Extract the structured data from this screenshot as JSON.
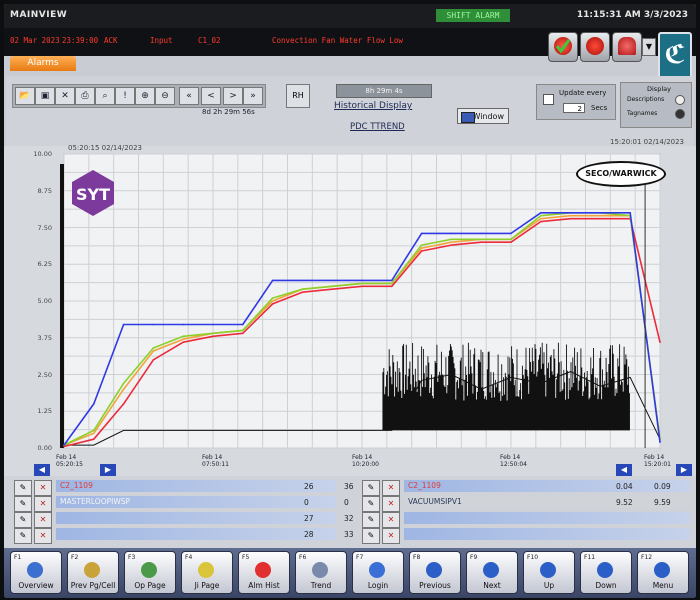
{
  "titlebar": {
    "app": "MAINVIEW",
    "shift_badge": "SHIFT ALARM",
    "clock": "11:15:31 AM 3/3/2023"
  },
  "alarm": {
    "date": "02 Mar 2023",
    "time": "23:39:00",
    "ack": "ACK",
    "type": "Input",
    "tag": "C1_02",
    "message": "Convection Fan Water Flow Low"
  },
  "alarms_tab": "Alarms",
  "toolbar": {
    "buttons": [
      "file-open-icon",
      "save-icon",
      "cut-icon",
      "print-icon",
      "search-icon",
      "alert-icon",
      "zoom-in-icon",
      "zoom-out-icon",
      "scroll-first-icon",
      "scroll-left-icon",
      "scroll-right-icon",
      "scroll-last-icon"
    ],
    "ranges": "8d  2h  29m  56s",
    "rh_label": "RH",
    "range_display": "8h 29m 4s",
    "historical_title": "Historical Display",
    "tag_title": "PDC TTREND",
    "window_label": "Window",
    "update_label": "Update every",
    "update_value": "2",
    "update_unit": "Secs",
    "display_title": "Display",
    "display_opt1": "Descriptions",
    "display_opt2": "Tagnames"
  },
  "chart": {
    "start_stamp": "05:20:15 02/14/2023",
    "end_stamp": "15:20:01 02/14/2023",
    "y_ticks": [
      "10.00",
      "8.75",
      "7.50",
      "6.25",
      "5.00",
      "3.75",
      "2.50",
      "1.25",
      "0.00"
    ],
    "x_labels": [
      {
        "d": "Feb 14",
        "t": "05:20:15"
      },
      {
        "d": "Feb 14",
        "t": "07:50:11"
      },
      {
        "d": "Feb 14",
        "t": "10:20:00"
      },
      {
        "d": "Feb 14",
        "t": "12:50:04"
      },
      {
        "d": "Feb 14",
        "t": "15:20:01"
      }
    ],
    "logo_left": "SYT",
    "logo_right": "SECO/WARWICK"
  },
  "chart_data": {
    "type": "line",
    "title": "PDC TTREND",
    "ylim": [
      0,
      10
    ],
    "x": [
      "05:20",
      "05:50",
      "06:20",
      "06:50",
      "07:20",
      "07:50",
      "08:20",
      "08:50",
      "09:20",
      "09:50",
      "10:20",
      "10:50",
      "11:20",
      "11:50",
      "12:20",
      "12:50",
      "13:20",
      "13:50",
      "14:20",
      "14:50",
      "15:20"
    ],
    "series": [
      {
        "name": "blue",
        "values": [
          0.1,
          1.5,
          4.2,
          4.2,
          4.2,
          4.2,
          4.2,
          5.7,
          5.7,
          5.7,
          5.7,
          5.7,
          7.3,
          7.3,
          7.3,
          7.3,
          8.0,
          8.0,
          8.0,
          8.0,
          0.2
        ]
      },
      {
        "name": "green",
        "values": [
          0.1,
          0.6,
          2.2,
          3.4,
          3.8,
          3.9,
          4.0,
          5.1,
          5.4,
          5.5,
          5.6,
          5.6,
          6.9,
          7.1,
          7.1,
          7.1,
          7.9,
          8.0,
          8.0,
          7.9,
          0.3
        ]
      },
      {
        "name": "orange",
        "values": [
          0.1,
          0.5,
          2.0,
          3.3,
          3.7,
          3.9,
          4.0,
          5.0,
          5.4,
          5.5,
          5.6,
          5.6,
          6.8,
          7.0,
          7.1,
          7.1,
          7.8,
          7.9,
          7.9,
          7.9,
          0.3
        ]
      },
      {
        "name": "red",
        "values": [
          0.05,
          0.3,
          1.5,
          3.0,
          3.6,
          3.8,
          3.9,
          4.9,
          5.3,
          5.4,
          5.5,
          5.5,
          6.7,
          6.9,
          7.0,
          7.0,
          7.7,
          7.8,
          7.8,
          7.8,
          3.6
        ]
      },
      {
        "name": "black",
        "values": [
          0.1,
          0.1,
          0.6,
          0.6,
          0.6,
          0.6,
          0.6,
          0.6,
          0.6,
          0.6,
          0.6,
          0.6,
          2.3,
          2.5,
          2.0,
          2.4,
          2.2,
          2.6,
          2.1,
          2.4,
          0.3
        ]
      }
    ]
  },
  "pens": {
    "left": [
      {
        "name": "C2_1109",
        "v1": "26",
        "v2": "36"
      },
      {
        "name": "MASTERLOOPIWSP",
        "v1": "0",
        "v2": "0"
      },
      {
        "name": "",
        "v1": "27",
        "v2": "32"
      },
      {
        "name": "",
        "v1": "28",
        "v2": "33"
      }
    ],
    "right": [
      {
        "name": "C2_1109",
        "v1": "0.04",
        "v2": "0.09"
      },
      {
        "name": "VACUUMSIPV1",
        "v1": "9.52",
        "v2": "9.59"
      },
      {
        "name": "",
        "v1": "",
        "v2": ""
      },
      {
        "name": "",
        "v1": "",
        "v2": ""
      }
    ]
  },
  "navbar": [
    {
      "key": "F1",
      "label": "Overview"
    },
    {
      "key": "F2",
      "label": "Prev Pg/Cell"
    },
    {
      "key": "F3",
      "label": "Op Page"
    },
    {
      "key": "F4",
      "label": "Ji Page"
    },
    {
      "key": "F5",
      "label": "Alm Hist"
    },
    {
      "key": "F6",
      "label": "Trend"
    },
    {
      "key": "F7",
      "label": "Login"
    },
    {
      "key": "F8",
      "label": "Previous"
    },
    {
      "key": "F9",
      "label": "Next"
    },
    {
      "key": "F10",
      "label": "Up"
    },
    {
      "key": "F11",
      "label": "Down"
    },
    {
      "key": "F12",
      "label": "Menu"
    }
  ],
  "colors": {
    "blue": "#2f39e6",
    "green": "#8bd12a",
    "orange": "#f2a33a",
    "red": "#ec2b3b",
    "black": "#111111",
    "alarm_text": "#ff3b2e"
  }
}
